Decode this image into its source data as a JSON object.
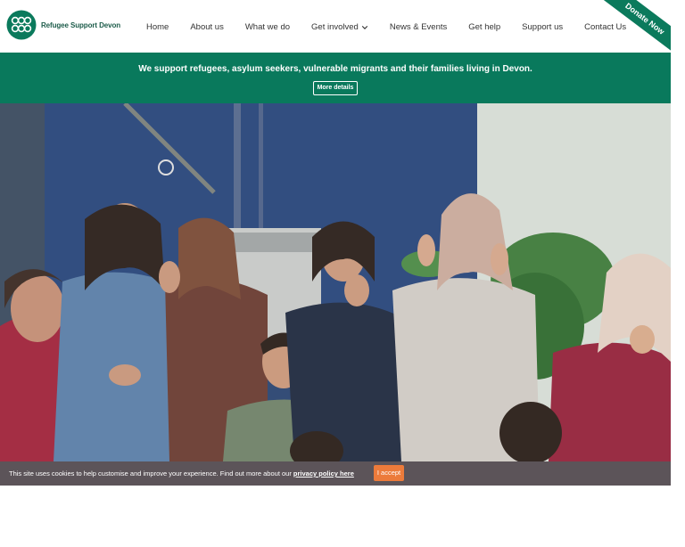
{
  "header": {
    "logo_text": "Refugee Support Devon",
    "nav": [
      {
        "label": "Home"
      },
      {
        "label": "About us"
      },
      {
        "label": "What we do"
      },
      {
        "label": "Get involved"
      },
      {
        "label": "News & Events"
      },
      {
        "label": "Get help"
      },
      {
        "label": "Support us"
      },
      {
        "label": "Contact Us"
      }
    ],
    "donate_label": "Donate Now"
  },
  "banner": {
    "text": "We support refugees, asylum seekers, vulnerable migrants and their families living in Devon.",
    "button_label": "More details"
  },
  "cookie": {
    "text": "This site uses cookies to help customise and improve your experience. Find out more about our ",
    "link_label": "privacy policy here",
    "accept_label": "I accept"
  },
  "colors": {
    "brand_green": "#09795c",
    "logo_green": "#1d5c4a",
    "cookie_bar": "#5c5459",
    "accept_orange": "#ec7b3b"
  }
}
